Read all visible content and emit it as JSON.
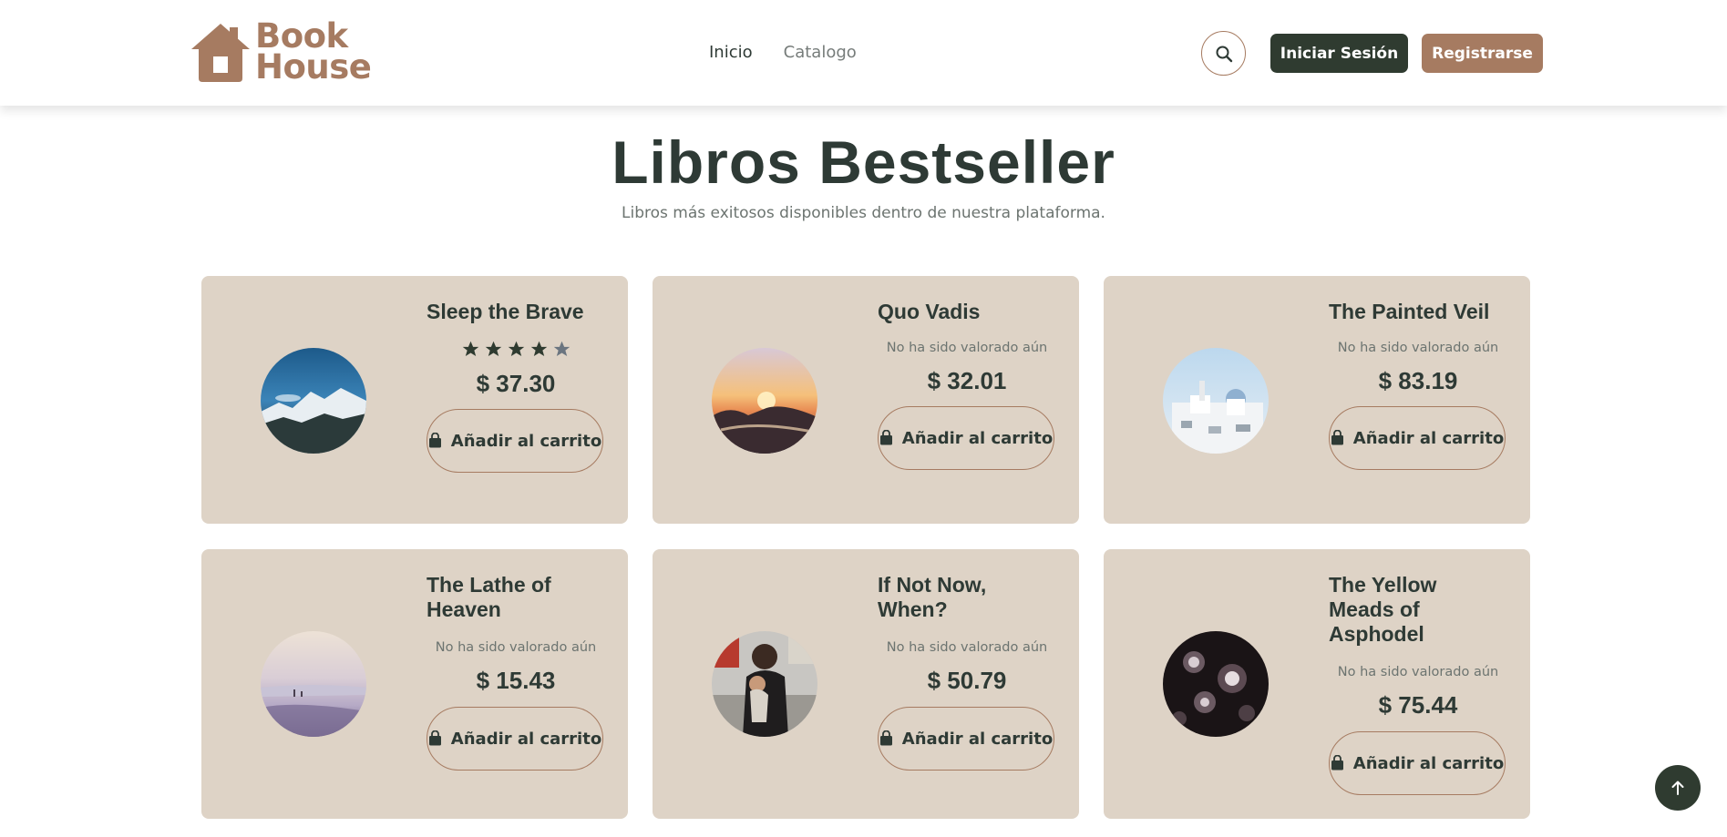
{
  "brand": {
    "line1": "Book",
    "line2": "House",
    "color": "#a67b61"
  },
  "nav": {
    "items": [
      {
        "label": "Inicio"
      },
      {
        "label": "Catalogo"
      }
    ]
  },
  "header": {
    "search_icon": "search-icon",
    "login_label": "Iniciar Sesión",
    "register_label": "Registrarse"
  },
  "section": {
    "title": "Libros Bestseller",
    "subtitle": "Libros más exitosos disponibles dentro de nuestra plataforma."
  },
  "books": [
    {
      "title": "Sleep the Brave",
      "rating": 4,
      "rating_max": 5,
      "price": "$ 37.30",
      "button": "Añadir al carrito",
      "image": "mountains-lake"
    },
    {
      "title": "Quo Vadis",
      "rating_text": "No ha sido valorado aún",
      "price": "$ 32.01",
      "button": "Añadir al carrito",
      "image": "sunset-sea-rocks"
    },
    {
      "title": "The Painted Veil",
      "rating_text": "No ha sido valorado aún",
      "price": "$ 83.19",
      "button": "Añadir al carrito",
      "image": "white-village"
    },
    {
      "title": "The Lathe of Heaven",
      "rating_text": "No ha sido valorado aún",
      "price": "$ 15.43",
      "button": "Añadir al carrito",
      "image": "misty-beach"
    },
    {
      "title": "If Not Now, When?",
      "rating_text": "No ha sido valorado aún",
      "price": "$ 50.79",
      "button": "Añadir al carrito",
      "image": "mother-child-street"
    },
    {
      "title": "The Yellow Meads of Asphodel",
      "rating_text": "No ha sido valorado aún",
      "price": "$ 75.44",
      "button": "Añadir al carrito",
      "image": "vintage-machinery"
    }
  ],
  "colors": {
    "dark_green": "#2f3b30",
    "card_bg": "#ded3c6",
    "accent_brown": "#a67b61",
    "star_empty": "#6b7580"
  },
  "scroll_top_icon": "arrow-up-icon"
}
